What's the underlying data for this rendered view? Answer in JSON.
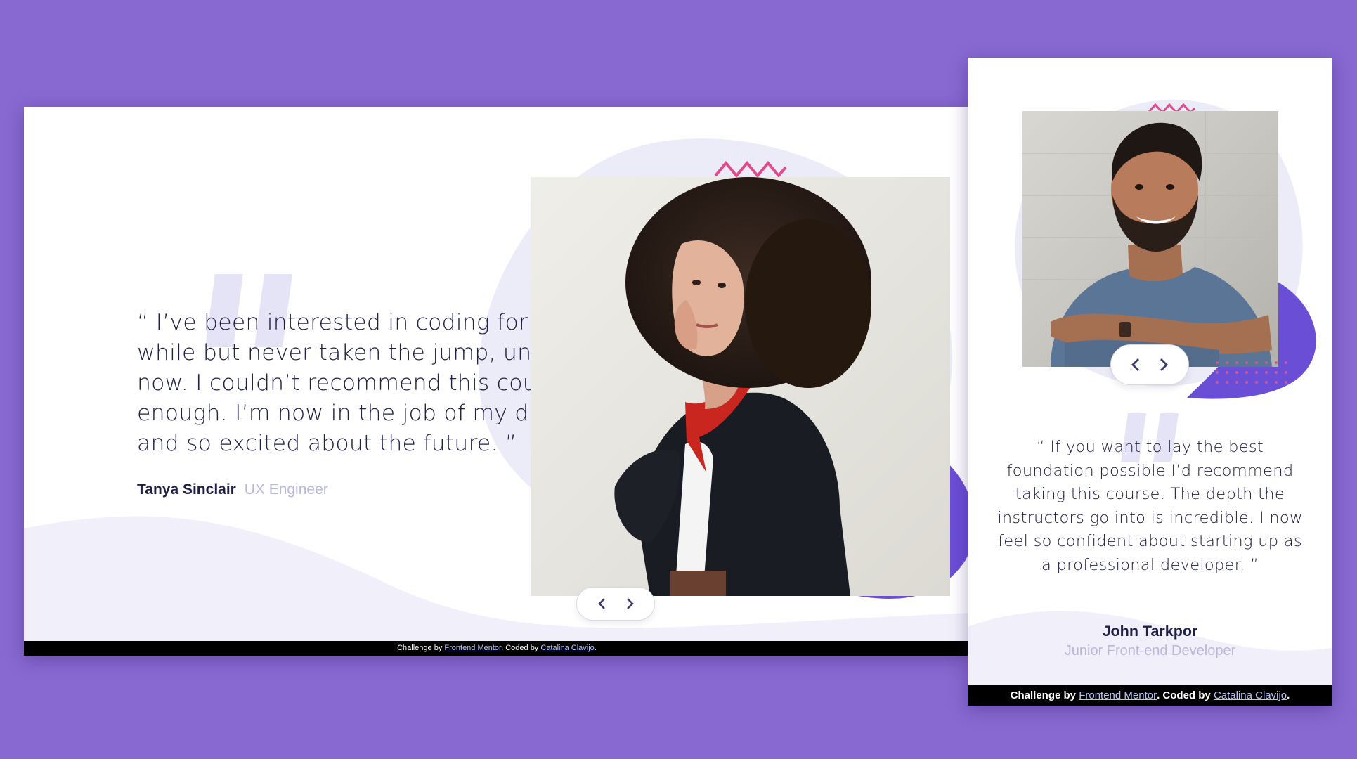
{
  "colors": {
    "page_background": "#8869d2",
    "card_background": "#ffffff",
    "text_dark": "#202046",
    "text_muted": "#b9b7d8",
    "accent_purple": "#6b4ed6",
    "blob_lavender": "#ececf8",
    "quote_mark": "#e5e3f6",
    "zigzag_pink": "#e24a8d",
    "footer_background": "#000000"
  },
  "desktop": {
    "testimonial": {
      "quote": "“ I’ve been interested in coding for a while but never taken the jump, until now. I couldn’t recommend this course enough. I’m now in the job of my dreams and so excited about the future. ”",
      "name": "Tanya Sinclair",
      "role": "UX Engineer",
      "photo": "woman-with-curly-hair-photo"
    },
    "controls": {
      "prev_icon": "chevron-left-icon",
      "next_icon": "chevron-right-icon"
    },
    "footer": {
      "prefix": "Challenge by ",
      "link1": "Frontend Mentor",
      "middle": ". Coded by ",
      "link2": "Catalina Clavijo",
      "suffix": "."
    }
  },
  "mobile": {
    "testimonial": {
      "quote": "“ If you want to lay the best foundation possible I’d recommend taking this course. The depth the instructors go into is incredible. I now feel so confident about starting up as a professional developer. ”",
      "name": "John Tarkpor",
      "role": "Junior Front-end Developer",
      "photo": "smiling-man-photo"
    },
    "controls": {
      "prev_icon": "chevron-left-icon",
      "next_icon": "chevron-right-icon"
    },
    "footer": {
      "prefix": "Challenge by ",
      "link1": "Frontend Mentor",
      "middle": ". Coded by ",
      "link2": "Catalina Clavijo",
      "suffix": "."
    }
  }
}
